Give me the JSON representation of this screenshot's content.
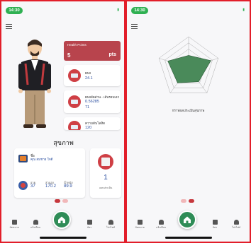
{
  "left_screen": {
    "status_time": "14:30",
    "status_signal": "▮",
    "health_points": {
      "label": "Health Points",
      "value": "5",
      "unit": "pts"
    },
    "stats": [
      {
        "icon": "blood-pressure-icon",
        "label": "BMI",
        "value": "24.1"
      },
      {
        "icon": "calculator-icon",
        "label": "BMIสัดส่วน - เส้นรอบเอว",
        "value": "0.56285",
        "value2": "71"
      },
      {
        "icon": "scale-icon",
        "label": "ความดันโลหิต",
        "value": "120"
      }
    ],
    "section_title": "สุขภาพ",
    "info": {
      "name_label": "ชื่อ",
      "name_value": "คุณ สมชาย ใจดี",
      "measures": [
        {
          "label": "อายุ",
          "value": "37"
        },
        {
          "label": "ส่วนสูง",
          "value": "170.2"
        },
        {
          "label": "น้ำหนัก",
          "value": "89.9"
        }
      ]
    },
    "side_card": {
      "value": "1",
      "label": "แบบประเมิน"
    }
  },
  "right_screen": {
    "status_time": "14:30",
    "status_signal": "▮",
    "radar_title": "กราฟผลประเมินสุขภาพ",
    "radar_levels": [
      0.4,
      0.75,
      0.55,
      0.6,
      0.7
    ],
    "radar_color": "#4a8a5a"
  },
  "tabs": [
    {
      "icon": "calendar-icon",
      "label": "นัดหมาย"
    },
    {
      "icon": "bell-icon",
      "label": "แจ้งเตือน"
    },
    {
      "icon": "home-icon",
      "label": ""
    },
    {
      "icon": "id-card-icon",
      "label": "บัตร"
    },
    {
      "icon": "person-icon",
      "label": "โปรไฟล์"
    }
  ],
  "colors": {
    "accent_red": "#e21e2a",
    "brand_green": "#2f8c57",
    "hp_card": "#b8444d"
  }
}
